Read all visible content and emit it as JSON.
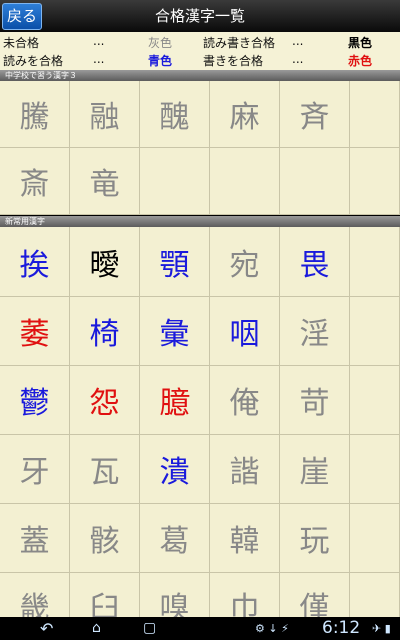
{
  "header": {
    "back_label": "戻る",
    "title": "合格漢字一覧"
  },
  "legend": [
    {
      "label": "未合格",
      "dots": "...",
      "color_name": "灰色",
      "color": "#888888"
    },
    {
      "label": "読みを合格",
      "dots": "...",
      "color_name": "青色",
      "color": "#1a1adc"
    },
    {
      "label": "読み書き合格",
      "dots": "...",
      "color_name": "黒色",
      "color": "#000000"
    },
    {
      "label": "書きを合格",
      "dots": "...",
      "color_name": "赤色",
      "color": "#e01010"
    }
  ],
  "sections": [
    {
      "title": "中学校で習う漢字３",
      "rows": [
        [
          {
            "k": "騰",
            "c": "#888888"
          },
          {
            "k": "融",
            "c": "#888888"
          },
          {
            "k": "醜",
            "c": "#888888"
          },
          {
            "k": "麻",
            "c": "#888888"
          },
          {
            "k": "斉",
            "c": "#888888"
          },
          {
            "k": "",
            "c": "#888888"
          }
        ],
        [
          {
            "k": "斎",
            "c": "#888888"
          },
          {
            "k": "竜",
            "c": "#888888"
          },
          {
            "k": "",
            "c": "#888888"
          },
          {
            "k": "",
            "c": "#888888"
          },
          {
            "k": "",
            "c": "#888888"
          },
          {
            "k": "",
            "c": "#888888"
          }
        ]
      ]
    },
    {
      "title": "新常用漢字",
      "rows": [
        [
          {
            "k": "挨",
            "c": "#1a1adc"
          },
          {
            "k": "曖",
            "c": "#000000"
          },
          {
            "k": "顎",
            "c": "#1a1adc"
          },
          {
            "k": "宛",
            "c": "#888888"
          },
          {
            "k": "畏",
            "c": "#1a1adc"
          },
          {
            "k": "",
            "c": "#888888"
          }
        ],
        [
          {
            "k": "萎",
            "c": "#e01010"
          },
          {
            "k": "椅",
            "c": "#1a1adc"
          },
          {
            "k": "彙",
            "c": "#1a1adc"
          },
          {
            "k": "咽",
            "c": "#1a1adc"
          },
          {
            "k": "淫",
            "c": "#888888"
          },
          {
            "k": "",
            "c": "#888888"
          }
        ],
        [
          {
            "k": "鬱",
            "c": "#1a1adc"
          },
          {
            "k": "怨",
            "c": "#e01010"
          },
          {
            "k": "臆",
            "c": "#e01010"
          },
          {
            "k": "俺",
            "c": "#888888"
          },
          {
            "k": "苛",
            "c": "#888888"
          },
          {
            "k": "",
            "c": "#888888"
          }
        ],
        [
          {
            "k": "牙",
            "c": "#888888"
          },
          {
            "k": "瓦",
            "c": "#888888"
          },
          {
            "k": "潰",
            "c": "#1a1adc"
          },
          {
            "k": "諧",
            "c": "#888888"
          },
          {
            "k": "崖",
            "c": "#888888"
          },
          {
            "k": "",
            "c": "#888888"
          }
        ],
        [
          {
            "k": "蓋",
            "c": "#888888"
          },
          {
            "k": "骸",
            "c": "#888888"
          },
          {
            "k": "葛",
            "c": "#888888"
          },
          {
            "k": "韓",
            "c": "#888888"
          },
          {
            "k": "玩",
            "c": "#888888"
          },
          {
            "k": "",
            "c": "#888888"
          }
        ],
        [
          {
            "k": "畿",
            "c": "#888888"
          },
          {
            "k": "臼",
            "c": "#888888"
          },
          {
            "k": "嗅",
            "c": "#888888"
          },
          {
            "k": "巾",
            "c": "#888888"
          },
          {
            "k": "僅",
            "c": "#888888"
          },
          {
            "k": "",
            "c": "#888888"
          }
        ]
      ]
    }
  ],
  "system_bar": {
    "back_icon": "back-icon",
    "home_icon": "home-icon",
    "recents_icon": "recents-icon",
    "time": "6:12"
  }
}
